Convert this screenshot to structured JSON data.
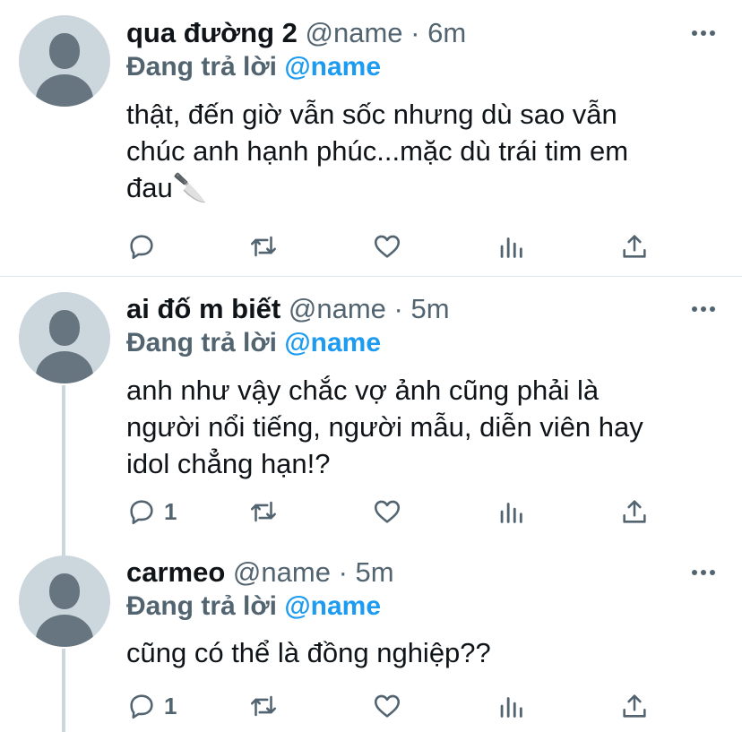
{
  "tweets": [
    {
      "display_name": "qua đường 2",
      "handle": "@name",
      "dot": "·",
      "time": "6m",
      "reply_prefix": "Đang trả lời",
      "reply_to": "@name",
      "text_lines": [
        "thật, đến giờ vẫn sốc nhưng dù sao vẫn",
        "chúc anh hạnh phúc...mặc dù trái tim em",
        "đau🔪"
      ],
      "reply_count": "",
      "retweet_count": "",
      "like_count": ""
    },
    {
      "display_name": "ai đố m biết",
      "handle": "@name",
      "dot": "·",
      "time": "5m",
      "reply_prefix": "Đang trả lời",
      "reply_to": "@name",
      "text_lines": [
        "anh như vậy chắc vợ ảnh cũng phải là",
        "người nổi tiếng, người mẫu, diễn viên hay",
        "idol chẳng hạn!?"
      ],
      "reply_count": "1",
      "retweet_count": "",
      "like_count": ""
    },
    {
      "display_name": "carmeo",
      "handle": "@name",
      "dot": "·",
      "time": "5m",
      "reply_prefix": "Đang trả lời",
      "reply_to": "@name",
      "text_lines": [
        "cũng có thể là đồng nghiệp??"
      ],
      "reply_count": "1",
      "retweet_count": "",
      "like_count": ""
    }
  ],
  "icons": {
    "reply": "reply-icon",
    "retweet": "retweet-icon",
    "like": "heart-icon",
    "analytics": "analytics-icon",
    "share": "share-icon",
    "more": "more-options-icon"
  },
  "colors": {
    "text": "#0f1419",
    "muted": "#536471",
    "mention": "#1d9bf0",
    "avatar_bg": "#ccd6dd",
    "avatar_fg": "#66757f",
    "divider": "#e1e8ed"
  }
}
